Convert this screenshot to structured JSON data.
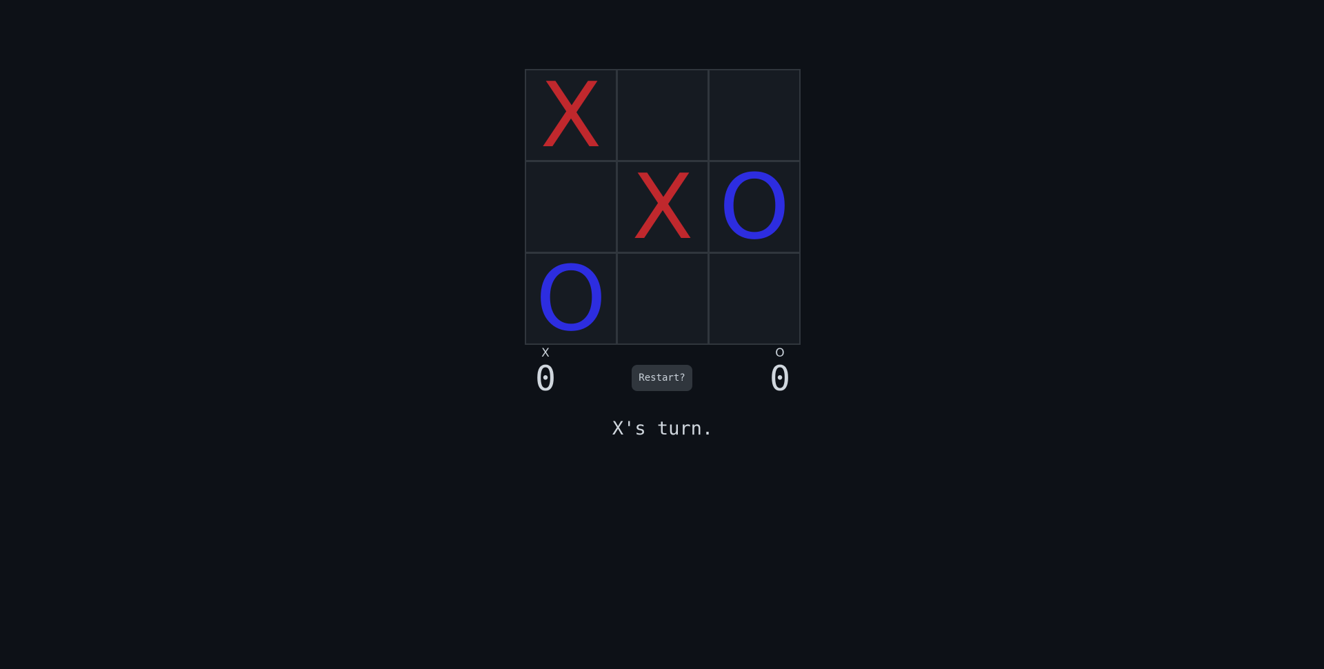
{
  "board": {
    "cells": [
      "X",
      "",
      "",
      "",
      "X",
      "O",
      "O",
      "",
      ""
    ]
  },
  "colors": {
    "background": "#0d1117",
    "x_mark": "#c0282d",
    "o_mark": "#2d2de0",
    "grid": "#30363d",
    "cell": "#161b22"
  },
  "scores": {
    "x": {
      "label": "X",
      "value": "0"
    },
    "o": {
      "label": "O",
      "value": "0"
    }
  },
  "restart_label": "Restart?",
  "status": "X's turn."
}
